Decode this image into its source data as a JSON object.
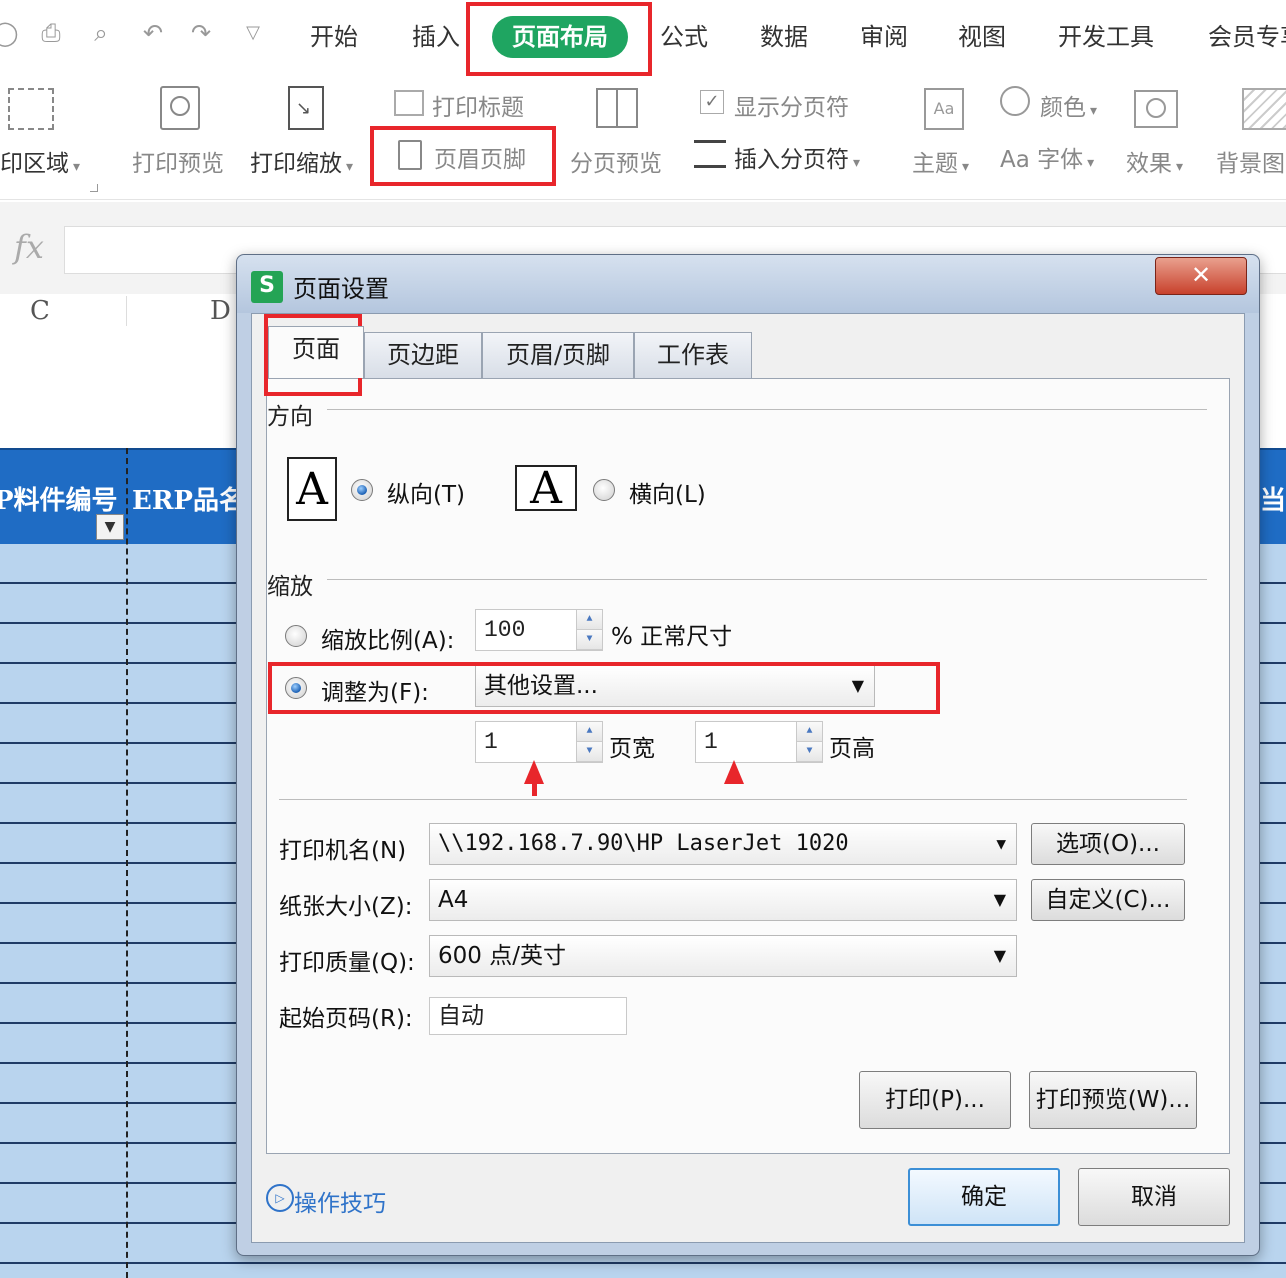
{
  "quick_access": {
    "icons": [
      "save-icon",
      "print-icon",
      "print-preview-icon",
      "undo-icon",
      "redo-icon",
      "customize-icon"
    ]
  },
  "menu": {
    "tabs": [
      "开始",
      "插入",
      "页面布局",
      "公式",
      "数据",
      "审阅",
      "视图",
      "开发工具",
      "会员专享"
    ],
    "active": "页面布局"
  },
  "ribbon": {
    "print_area": "印区域",
    "print_preview": "打印预览",
    "print_scale": "打印缩放",
    "print_titles": "打印标题",
    "header_footer": "页眉页脚",
    "page_break_preview": "分页预览",
    "show_page_breaks": "显示分页符",
    "insert_page_break": "插入分页符",
    "theme": "主题",
    "colors": "颜色",
    "fonts_prefix": "Aa",
    "fonts": "字体",
    "effects": "效果",
    "background": "背景图"
  },
  "formula_bar": {
    "fx": "fx"
  },
  "sheet": {
    "col_c": "C",
    "col_d": "D",
    "header_1": "P料件编号",
    "header_2": "ERP品名",
    "header_right": "当"
  },
  "dialog": {
    "title": "页面设置",
    "logo": "S",
    "close": "✕",
    "tabs": [
      "页面",
      "页边距",
      "页眉/页脚",
      "工作表"
    ],
    "orientation": {
      "label": "方向",
      "portrait": "纵向(T)",
      "landscape": "横向(L)",
      "icon_letter": "A",
      "selected": "portrait"
    },
    "scaling": {
      "label": "缩放",
      "scale_label": "缩放比例(A):",
      "scale_value": "100",
      "scale_suffix": "% 正常尺寸",
      "fit_label": "调整为(F):",
      "fit_option": "其他设置...",
      "pages_wide": "1",
      "pages_wide_label": "页宽",
      "pages_tall": "1",
      "pages_tall_label": "页高",
      "selected": "fit"
    },
    "printer_name_label": "打印机名(N)",
    "printer_name": "\\\\192.168.7.90\\HP LaserJet 1020",
    "options_button": "选项(O)...",
    "paper_size_label": "纸张大小(Z):",
    "paper_size": "A4",
    "custom_button": "自定义(C)...",
    "print_quality_label": "打印质量(Q):",
    "print_quality": "600 点/英寸",
    "first_page_label": "起始页码(R):",
    "first_page": "自动",
    "print_button": "打印(P)...",
    "print_preview_button": "打印预览(W)...",
    "tips": "操作技巧",
    "ok": "确定",
    "cancel": "取消"
  },
  "colors": {
    "accent_green": "#1fa561",
    "highlight_red": "#e8262b",
    "sheet_header_blue": "#1f6cc4",
    "sheet_row_blue": "#b9d4ee"
  }
}
